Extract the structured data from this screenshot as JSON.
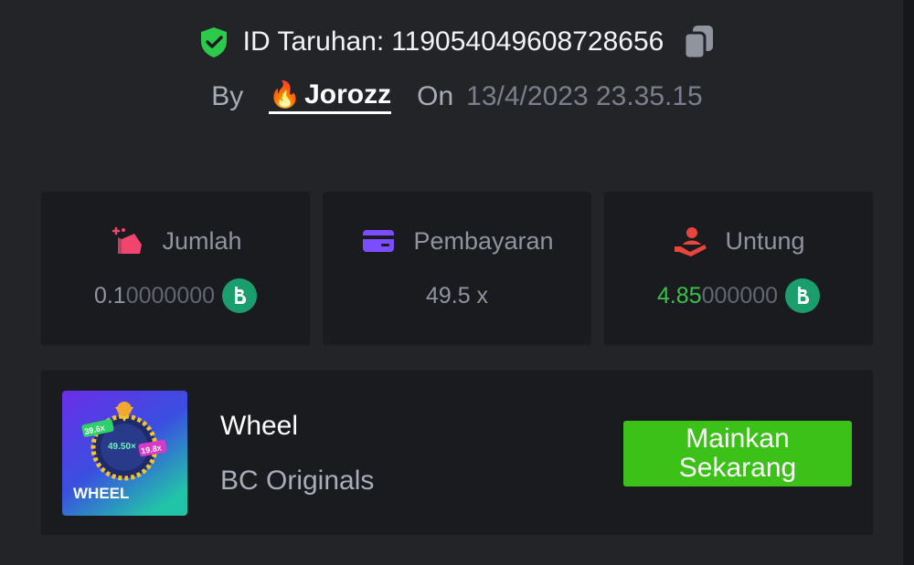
{
  "bet": {
    "id_label": "ID Taruhan:",
    "id_value": "119054049608728656",
    "by_label": "By",
    "user_emoji": "🔥",
    "username": "Jorozz",
    "on_label": "On",
    "date": "13/4/2023 23.35.15"
  },
  "stats": {
    "amount": {
      "label": "Jumlah",
      "value_main": "0.1",
      "value_dim": "0000000"
    },
    "payout": {
      "label": "Pembayaran",
      "value": "49.5 x"
    },
    "profit": {
      "label": "Untung",
      "value_main": "4.85",
      "value_dim": "000000"
    }
  },
  "game": {
    "name": "Wheel",
    "provider": "BC Originals",
    "thumb_title": "WHEEL",
    "thumb_badge_1": "39.6x",
    "thumb_badge_2": "49.50×",
    "thumb_badge_3": "19.8x",
    "play_label": "Mainkan Sekarang"
  },
  "colors": {
    "background": "#232428",
    "card": "#1a1b1f",
    "accent_green": "#3bc117",
    "profit_green": "#3ac04a",
    "coin": "#1b9e6e"
  }
}
